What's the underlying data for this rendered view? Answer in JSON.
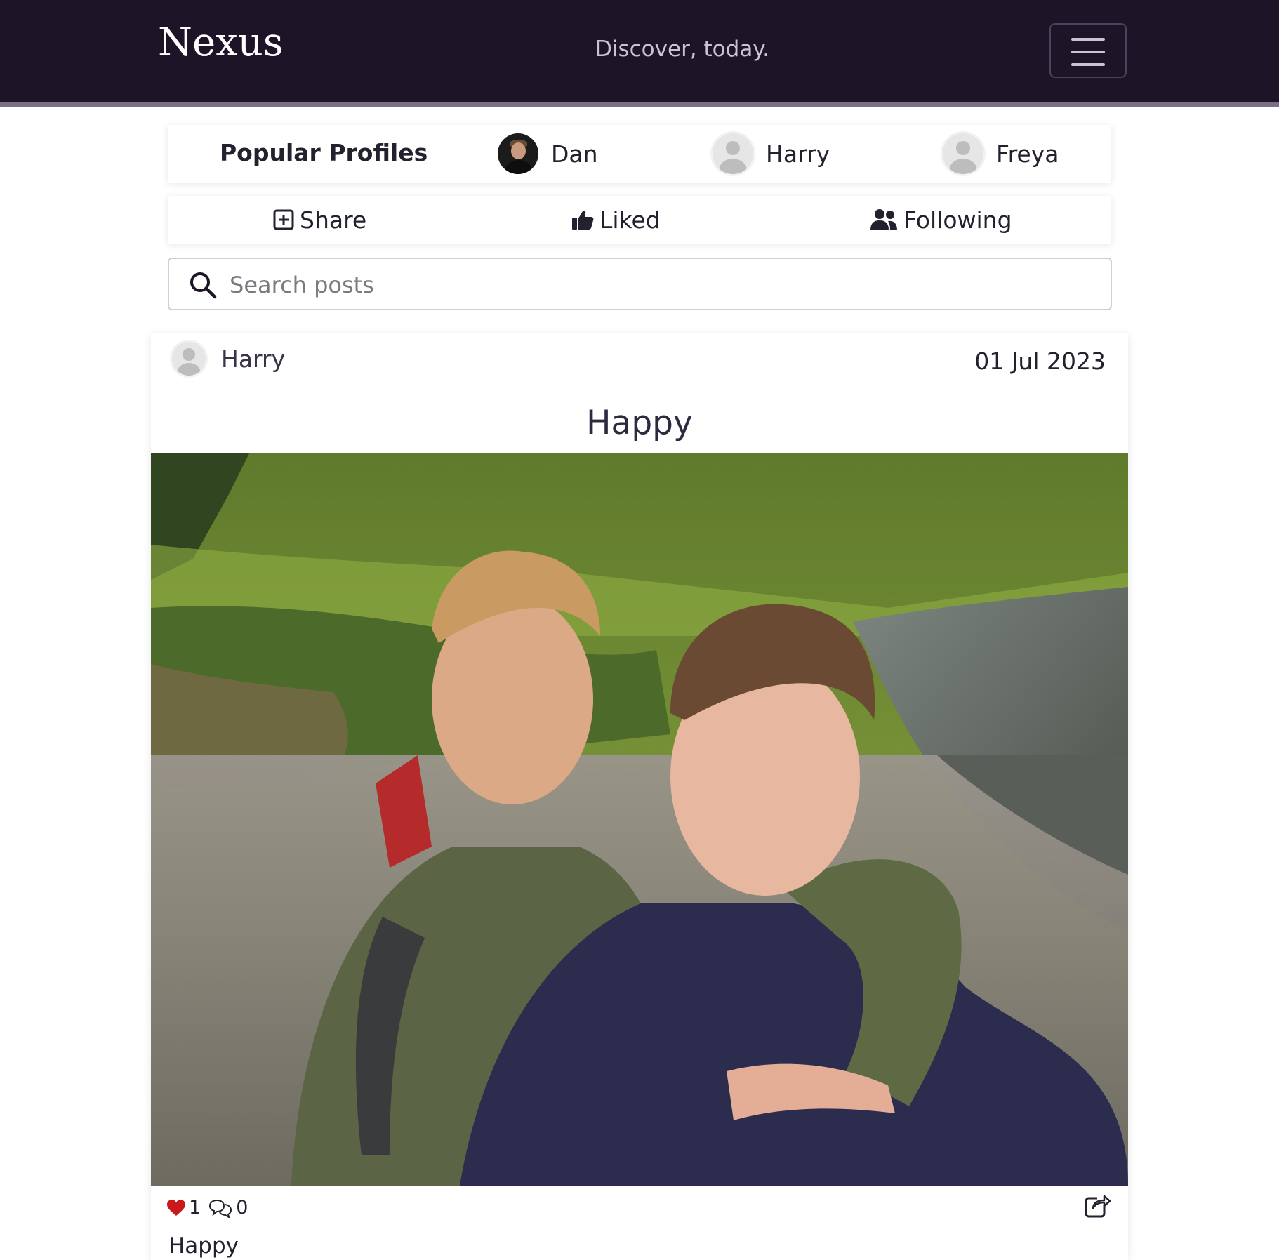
{
  "navbar": {
    "brand": "Nexus",
    "tagline": "Discover, today.",
    "menu_icon": "hamburger-icon"
  },
  "popular_profiles": {
    "title": "Popular Profiles",
    "profiles": [
      {
        "name": "Dan",
        "avatar": "photo"
      },
      {
        "name": "Harry",
        "avatar": "default-user-icon"
      },
      {
        "name": "Freya",
        "avatar": "default-user-icon"
      }
    ]
  },
  "tabs": [
    {
      "label": "Share",
      "icon": "plus-square-icon"
    },
    {
      "label": "Liked",
      "icon": "thumbs-up-icon"
    },
    {
      "label": "Following",
      "icon": "users-icon"
    }
  ],
  "search": {
    "placeholder": "Search posts",
    "value": ""
  },
  "post": {
    "author": "Harry",
    "date": "01 Jul 2023",
    "title": "Happy",
    "likes": "1",
    "comments": "0",
    "caption": "Happy",
    "colors": {
      "like": "#c8191d"
    }
  },
  "colors": {
    "navbar_bg": "#1d1427",
    "navbar_accent": "#7c6e86"
  }
}
